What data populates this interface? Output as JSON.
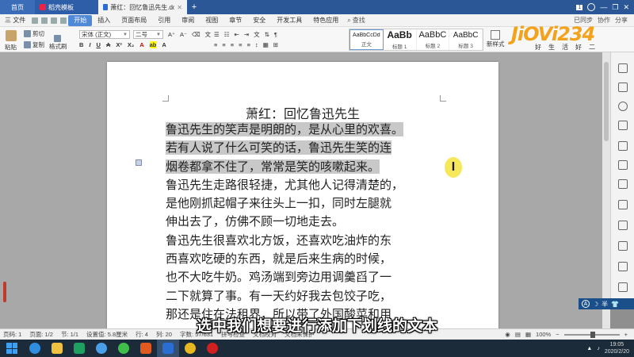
{
  "tabs": {
    "home": "首页",
    "template": "稻壳模板",
    "doc": "萧红：回忆鲁迅先生.docx",
    "add": "+"
  },
  "menu": {
    "file": "三 文件",
    "items": [
      "开始",
      "插入",
      "页面布局",
      "引用",
      "审阅",
      "视图",
      "章节",
      "安全",
      "开发工具",
      "特色应用"
    ],
    "active_index": 0,
    "search": "查找",
    "right": [
      "已同步",
      "协作",
      "分享"
    ]
  },
  "ribbon": {
    "paste": "粘贴",
    "cut": "剪切",
    "copy": "复制",
    "format_painter": "格式刷",
    "font_name": "宋体 (正文)",
    "font_size": "二号",
    "styles": [
      {
        "sample": "AaBbCcDd",
        "name": "正文"
      },
      {
        "sample": "AaBb",
        "name": "标题 1"
      },
      {
        "sample": "AaBbC",
        "name": "标题 2"
      },
      {
        "sample": "AaBbC",
        "name": "标题 3"
      }
    ],
    "new_style": "新样式"
  },
  "logo": {
    "brand": "JiOVi234",
    "slogan": "好生活好二"
  },
  "document": {
    "title": "萧红：回忆鲁迅先生",
    "lines": [
      {
        "text": "鲁迅先生的笑声是明朗的，是从心里的欢喜。",
        "highlighted": true
      },
      {
        "text": "若有人说了什么可笑的话，鲁迅先生笑的连",
        "highlighted": true
      },
      {
        "text": "烟卷都拿不住了，常常是笑的咳嗽起来。",
        "highlighted": true
      },
      {
        "text": "鲁迅先生走路很轻捷，尤其他人记得清楚的，",
        "highlighted": false
      },
      {
        "text": "是他刚抓起帽子来往头上一扣，同时左腿就",
        "highlighted": false
      },
      {
        "text": "伸出去了，仿佛不顾一切地走去。",
        "highlighted": false
      },
      {
        "text": "鲁迅先生很喜欢北方饭，还喜欢吃油炸的东",
        "highlighted": false
      },
      {
        "text": "西喜欢吃硬的东西，就是后来生病的时候，",
        "highlighted": false
      },
      {
        "text": "也不大吃牛奶。鸡汤端到旁边用调羹舀了一",
        "highlighted": false
      },
      {
        "text": "二下就算了事。有一天约好我去包饺子吃，",
        "highlighted": false
      },
      {
        "text": "那还是住在法租界，所以带了外国酸菜和用",
        "highlighted": false
      }
    ],
    "cursor_glyph": "I"
  },
  "subtitle": "选中我们想要进行添加下划线的文本",
  "ime": {
    "label": "半"
  },
  "status": {
    "page": "页码: 1",
    "pages": "页面: 1/2",
    "section": "节: 1/1",
    "setting": "设置值: 5.8厘米",
    "row": "行: 4",
    "col": "列: 20",
    "words": "字数: 57/631",
    "spell": "拼写检查",
    "compare": "文档校对",
    "protect": "文档未保护",
    "zoom": "100%"
  },
  "clock": {
    "time": "19:05",
    "date": "2020/2/20"
  },
  "colors": {
    "tabbar": "#2b5797",
    "accent": "#4f8ad9",
    "logo": "#f3a21c",
    "taskbar": "#1c2b3a"
  }
}
